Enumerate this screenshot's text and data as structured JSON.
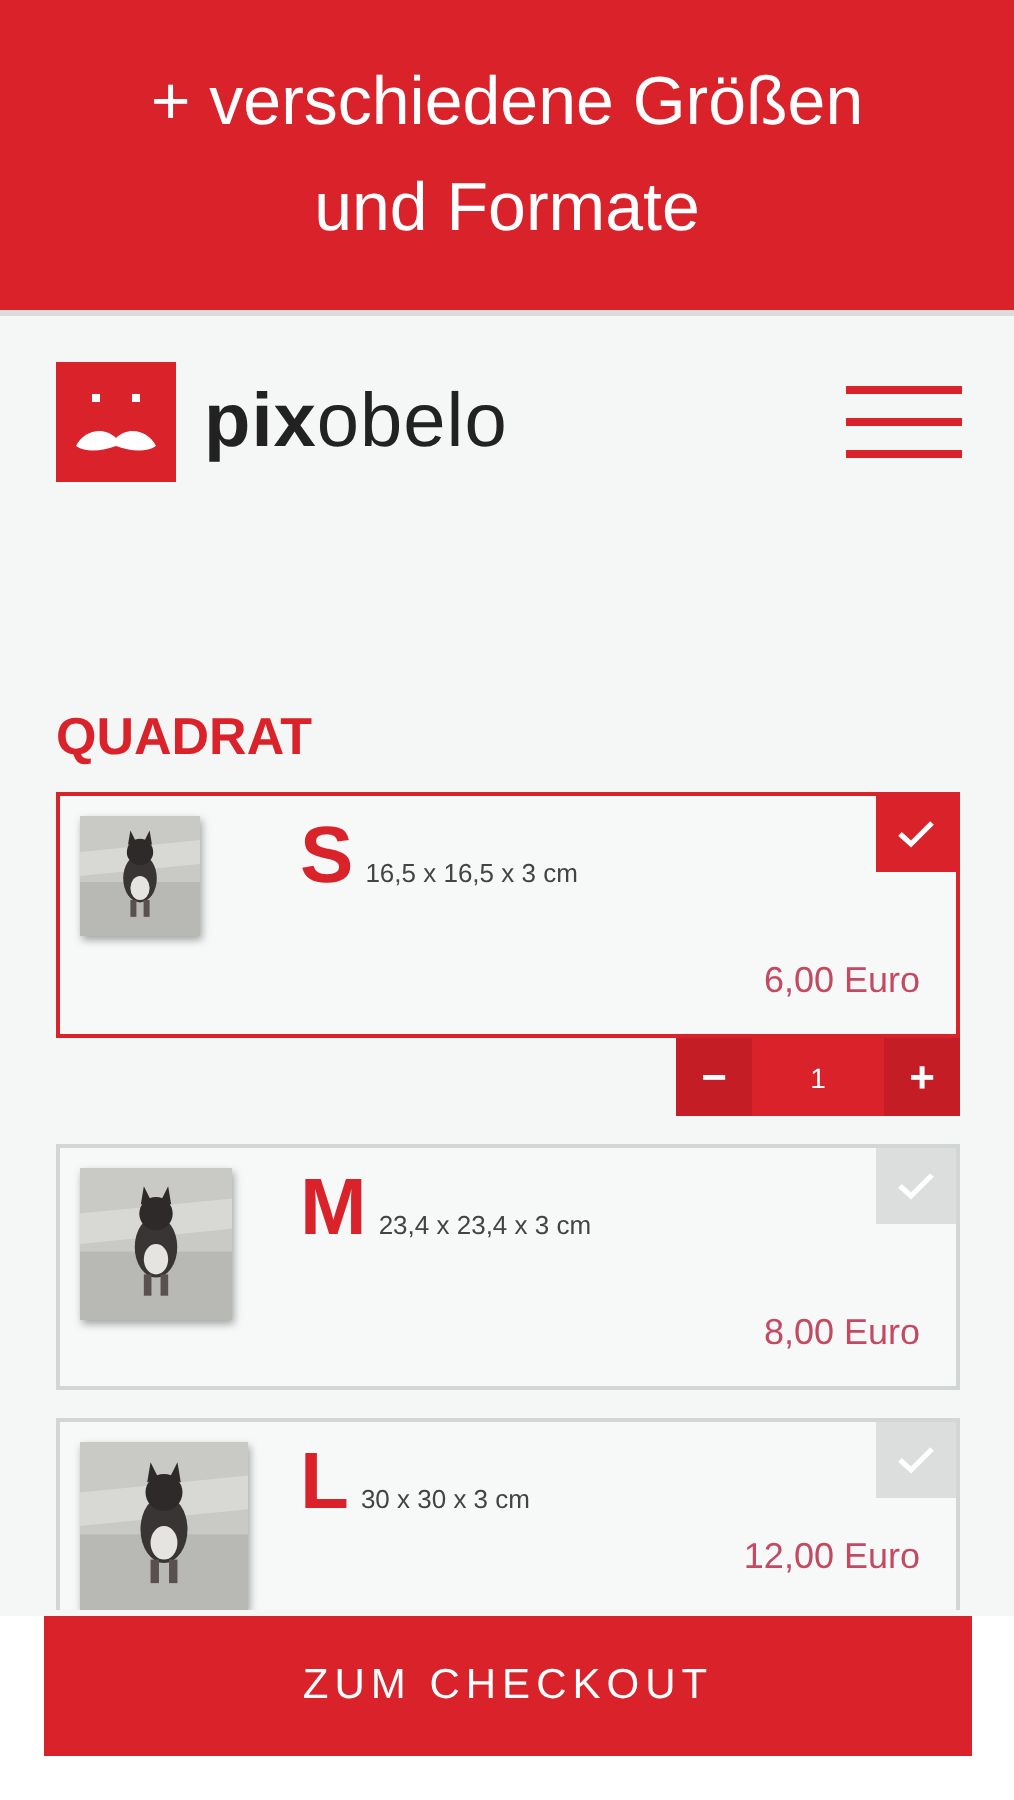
{
  "banner": {
    "title": "+ verschiedene Größen und Formate"
  },
  "header": {
    "logo": "**pix**obelo"
  },
  "section": {
    "title": "QUADRAT"
  },
  "products": [
    {
      "size": "S",
      "dimensions": "16,5 x 16,5 x 3 cm",
      "price": "6,00 Euro",
      "selected": true,
      "quantity": {
        "minus": "−",
        "value": "1",
        "plus": "+"
      }
    },
    {
      "size": "M",
      "dimensions": "23,4 x 23,4 x 3 cm",
      "price": "8,00 Euro",
      "selected": false
    },
    {
      "size": "L",
      "dimensions": "30 x 30 x 3 cm",
      "price": "12,00 Euro",
      "selected": false
    }
  ],
  "checkout": {
    "label": "ZUM CHECKOUT"
  }
}
